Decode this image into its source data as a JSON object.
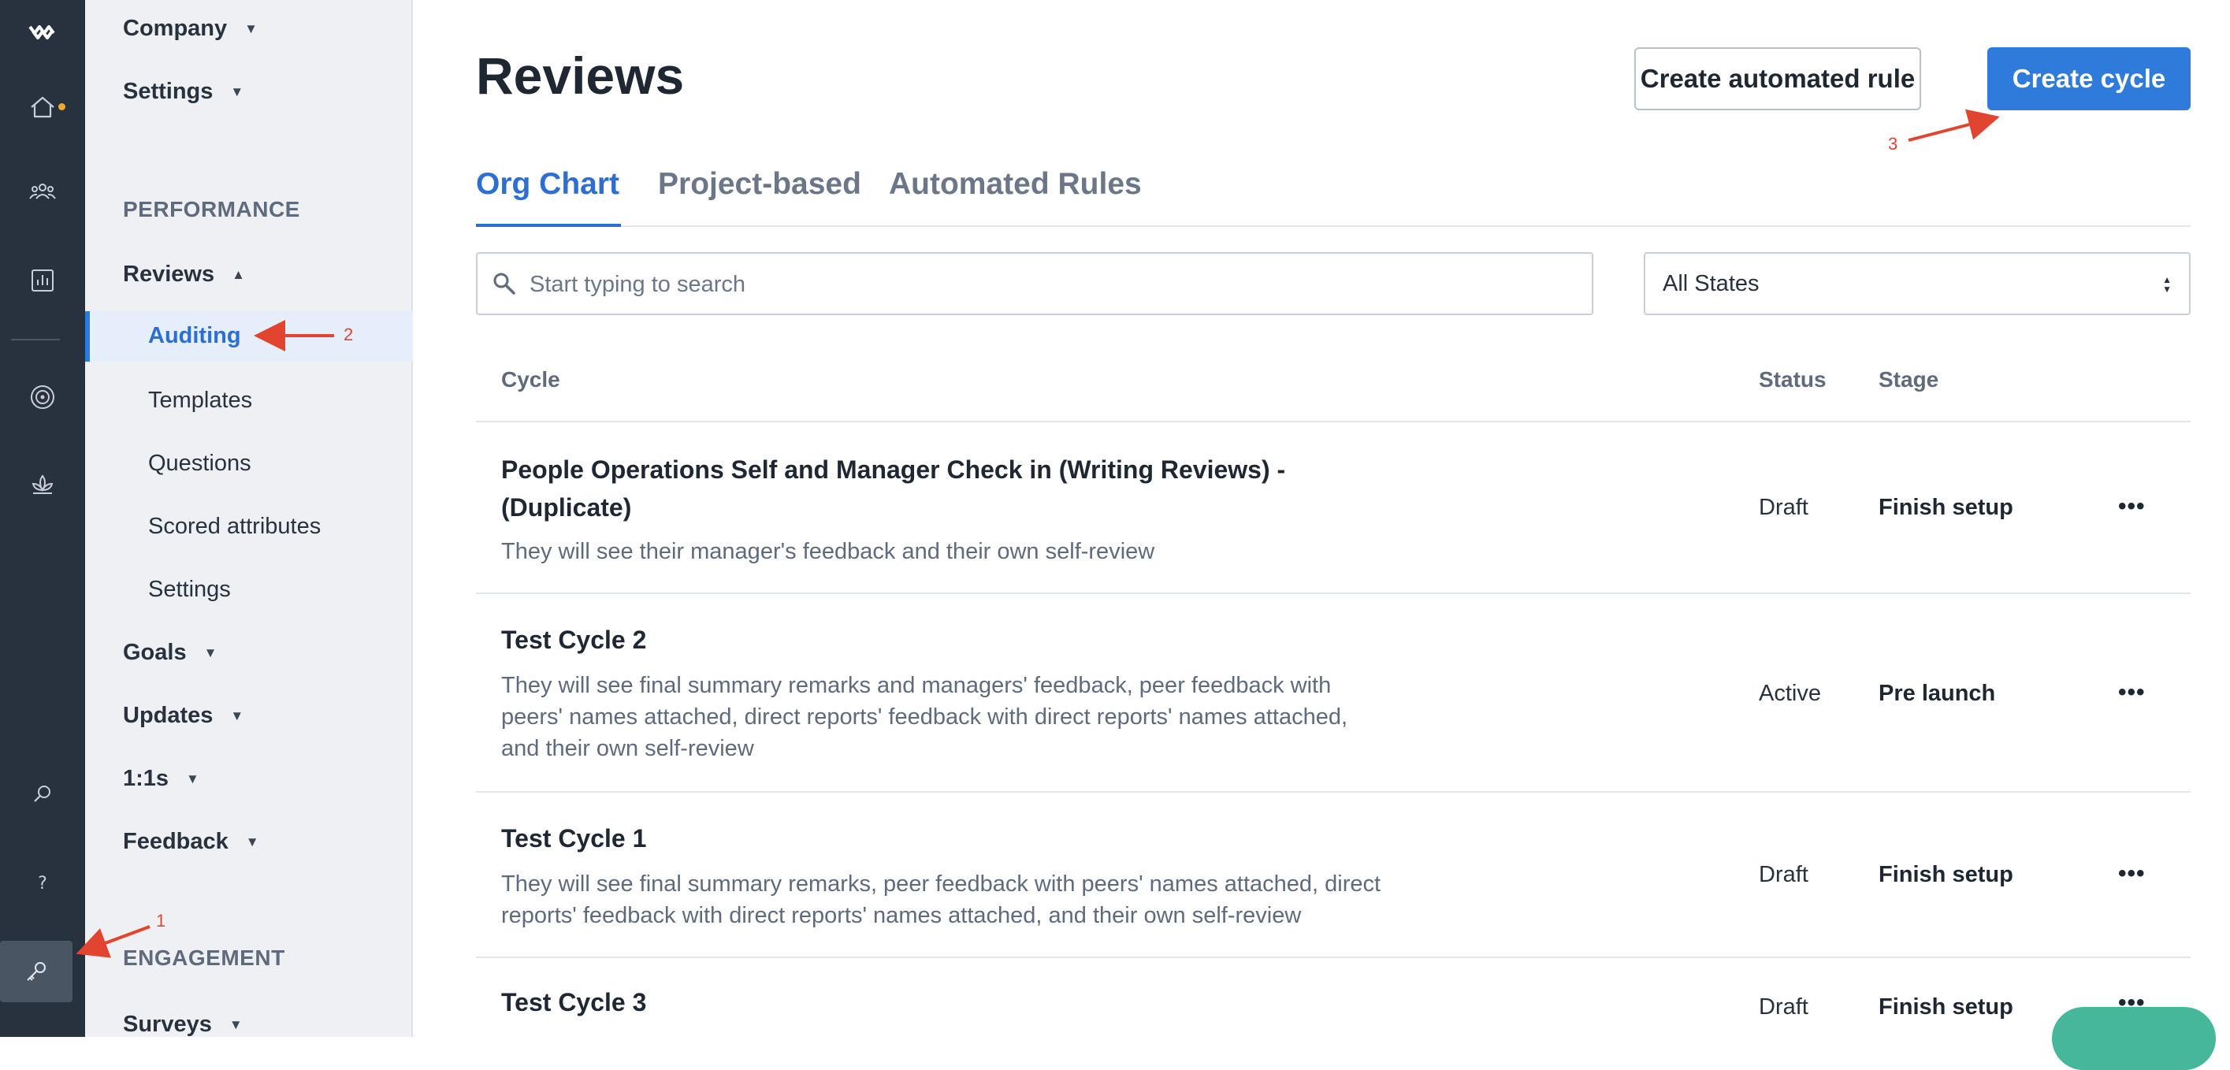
{
  "rail": {
    "items": [
      "logo-icon",
      "home-icon",
      "people-icon",
      "analytics-icon",
      "goals-icon",
      "wellbeing-icon",
      "search-icon",
      "help-icon",
      "admin-key-icon"
    ]
  },
  "nav": {
    "top_items": [
      {
        "label": "Company"
      },
      {
        "label": "Settings"
      }
    ],
    "performance_section": "PERFORMANCE",
    "reviews_label": "Reviews",
    "reviews_subitems": [
      {
        "label": "Auditing",
        "active": true
      },
      {
        "label": "Templates"
      },
      {
        "label": "Questions"
      },
      {
        "label": "Scored attributes"
      },
      {
        "label": "Settings"
      }
    ],
    "other_items": [
      {
        "label": "Goals"
      },
      {
        "label": "Updates"
      },
      {
        "label": "1:1s"
      },
      {
        "label": "Feedback"
      }
    ],
    "engagement_section": "ENGAGEMENT",
    "surveys_label": "Surveys"
  },
  "header": {
    "title": "Reviews",
    "automated_rule_button": "Create automated rule",
    "create_cycle_button": "Create cycle"
  },
  "tabs": [
    {
      "label": "Org Chart",
      "active": true
    },
    {
      "label": "Project-based"
    },
    {
      "label": "Automated Rules"
    }
  ],
  "search": {
    "placeholder": "Start typing to search"
  },
  "state_filter": {
    "value": "All States"
  },
  "table": {
    "columns": {
      "cycle": "Cycle",
      "status": "Status",
      "stage": "Stage"
    },
    "rows": [
      {
        "name": "People Operations Self and Manager Check in (Writing Reviews) - (Duplicate)",
        "description": "They will see their manager's feedback and their own self-review",
        "status": "Draft",
        "stage": "Finish setup",
        "more": "•••"
      },
      {
        "name": "Test Cycle 2",
        "description": "They will see final summary remarks and managers' feedback, peer feedback with peers' names attached, direct reports' feedback with direct reports' names attached, and their own self-review",
        "status": "Active",
        "stage": "Pre launch",
        "more": "•••"
      },
      {
        "name": "Test Cycle 1",
        "description": "They will see final summary remarks, peer feedback with peers' names attached, direct reports' feedback with direct reports' names attached, and their own self-review",
        "status": "Draft",
        "stage": "Finish setup",
        "more": "•••"
      },
      {
        "name": "Test Cycle 3",
        "description": "",
        "status": "Draft",
        "stage": "Finish setup",
        "more": "•••"
      }
    ]
  },
  "annotations": [
    "1",
    "2",
    "3"
  ],
  "colors": {
    "rail_bg": "#28323f",
    "nav_bg": "#eef0f4",
    "accent": "#2c6fd1",
    "primary_button": "#2f7bdb",
    "annotation": "#e2452f",
    "notification_dot": "#f0a92e"
  }
}
